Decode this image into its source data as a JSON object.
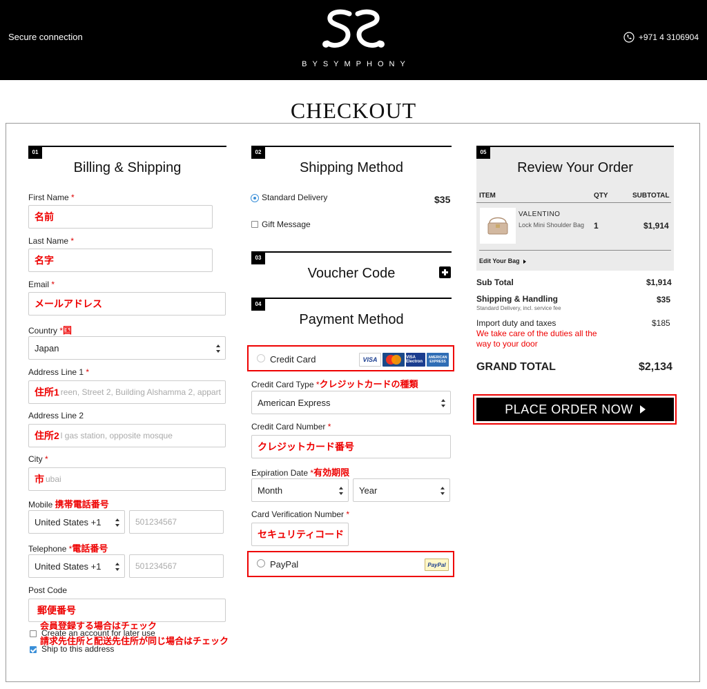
{
  "header": {
    "secure": "Secure connection",
    "brand": "BYSYMPHONY",
    "phone": "+971 4 3106904",
    "icons": {
      "logo": "ss-monogram-logo",
      "phone": "phone-icon"
    }
  },
  "page": {
    "title": "CHECKOUT"
  },
  "billing": {
    "num": "01",
    "title": "Billing & Shipping",
    "first_name": {
      "label": "First Name",
      "req": "*",
      "note": "名前"
    },
    "last_name": {
      "label": "Last Name",
      "req": "*",
      "note": "名字"
    },
    "email": {
      "label": "Email",
      "req": "*",
      "note": "メールアドレス"
    },
    "country": {
      "label": "Country",
      "req": "*",
      "note": "国",
      "value": "Japan"
    },
    "address1": {
      "label": "Address Line 1",
      "req": "*",
      "note": "住所1",
      "placeholder": "reen, Street 2, Building Alshamma 2, appart"
    },
    "address2": {
      "label": "Address Line 2",
      "note": "住所2",
      "placeholder": "l gas station, opposite mosque"
    },
    "city": {
      "label": "City",
      "req": "*",
      "note": "市",
      "placeholder": "ubai"
    },
    "mobile": {
      "label": "Mobile",
      "note": "携帯電話番号",
      "code": "United States +1",
      "placeholder": "501234567"
    },
    "telephone": {
      "label": "Telephone",
      "req": "*",
      "note": "電話番号",
      "code": "United States +1",
      "placeholder": "501234567"
    },
    "postcode": {
      "label": "Post Code",
      "note": "郵便番号"
    },
    "create_account": {
      "label": "Create an account for later use",
      "note": "会員登録する場合はチェック"
    },
    "ship_same": {
      "label": "Ship to this address",
      "note": "請求先住所と配送先住所が同じ場合はチェック"
    }
  },
  "shipping": {
    "num": "02",
    "title": "Shipping Method",
    "standard": {
      "label": "Standard Delivery",
      "price": "$35"
    },
    "gift": "Gift Message"
  },
  "voucher": {
    "num": "03",
    "title": "Voucher Code"
  },
  "payment": {
    "num": "04",
    "title": "Payment Method",
    "credit_card": "Credit Card",
    "card_logos": [
      "VISA",
      "MasterCard",
      "VISA Electron",
      "AMERICAN EXPRESS"
    ],
    "card_type": {
      "label": "Credit Card Type",
      "req": "*",
      "note": "クレジットカードの種類",
      "value": "American Express"
    },
    "card_number": {
      "label": "Credit Card Number",
      "req": "*",
      "note": "クレジットカード番号"
    },
    "expiry": {
      "label": "Expiration Date",
      "req": "*",
      "note": "有効期限",
      "month": "Month",
      "year": "Year"
    },
    "cvn": {
      "label": "Card Verification Number",
      "req": "*",
      "note": "セキュリティコード"
    },
    "paypal": "PayPal",
    "paypal_logo": "PayPal"
  },
  "review": {
    "num": "05",
    "title": "Review Your Order",
    "cols": {
      "item": "ITEM",
      "qty": "QTY",
      "subtotal": "SUBTOTAL"
    },
    "product": {
      "brand": "VALENTINO",
      "name": "Lock Mini Shoulder Bag",
      "qty": "1",
      "subtotal": "$1,914"
    },
    "edit_bag": "Edit Your Bag",
    "sub_total": {
      "label": "Sub Total",
      "value": "$1,914"
    },
    "shipping_handling": {
      "label": "Shipping & Handling",
      "sub": "Standard Delivery, incl. service fee",
      "value": "$35"
    },
    "import": {
      "label": "Import duty and taxes",
      "value": "$185",
      "note": "We take care of the duties all the way to your door"
    },
    "grand_total": {
      "label": "GRAND TOTAL",
      "value": "$2,134"
    },
    "place_order": "PLACE ORDER NOW"
  }
}
